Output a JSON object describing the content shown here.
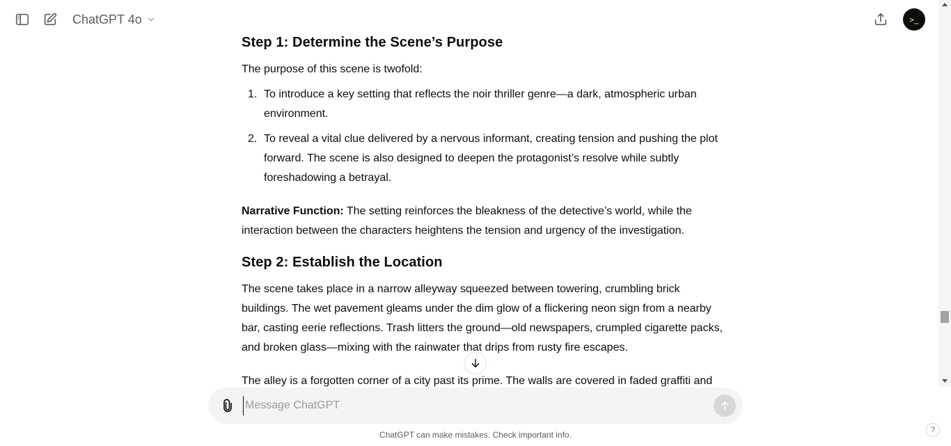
{
  "header": {
    "model_label": "ChatGPT 4o",
    "avatar_text": ">_"
  },
  "conversation": {
    "step1_heading": "Step 1: Determine the Scene’s Purpose",
    "step1_intro": "The purpose of this scene is twofold:",
    "step1_items": [
      {
        "num": "1.",
        "text": "To introduce a key setting that reflects the noir thriller genre—a dark, atmospheric urban environment."
      },
      {
        "num": "2.",
        "text": "To reveal a vital clue delivered by a nervous informant, creating tension and pushing the plot forward. The scene is also designed to deepen the protagonist’s resolve while subtly foreshadowing a betrayal."
      }
    ],
    "narrative_label": "Narrative Function:",
    "narrative_text": " The setting reinforces the bleakness of the detective’s world, while the interaction between the characters heightens the tension and urgency of the investigation.",
    "step2_heading": "Step 2: Establish the Location",
    "step2_para1": "The scene takes place in a narrow alleyway squeezed between towering, crumbling brick buildings. The wet pavement gleams under the dim glow of a flickering neon sign from a nearby bar, casting eerie reflections. Trash litters the ground—old newspapers, crumpled cigarette packs, and broken glass—mixing with the rainwater that drips from rusty fire escapes.",
    "step2_para2": "The alley is a forgotten corner of a city past its prime. The walls are covered in faded graffiti and"
  },
  "composer": {
    "placeholder": "Message ChatGPT"
  },
  "footer": {
    "disclaimer": "ChatGPT can make mistakes. Check important info.",
    "help_label": "?"
  },
  "icons": {
    "sidebar_toggle": "sidebar-icon",
    "new_chat": "edit-icon",
    "share": "share-icon",
    "attach": "paperclip-icon",
    "send": "arrow-up-icon",
    "scroll_down": "arrow-down-icon"
  }
}
